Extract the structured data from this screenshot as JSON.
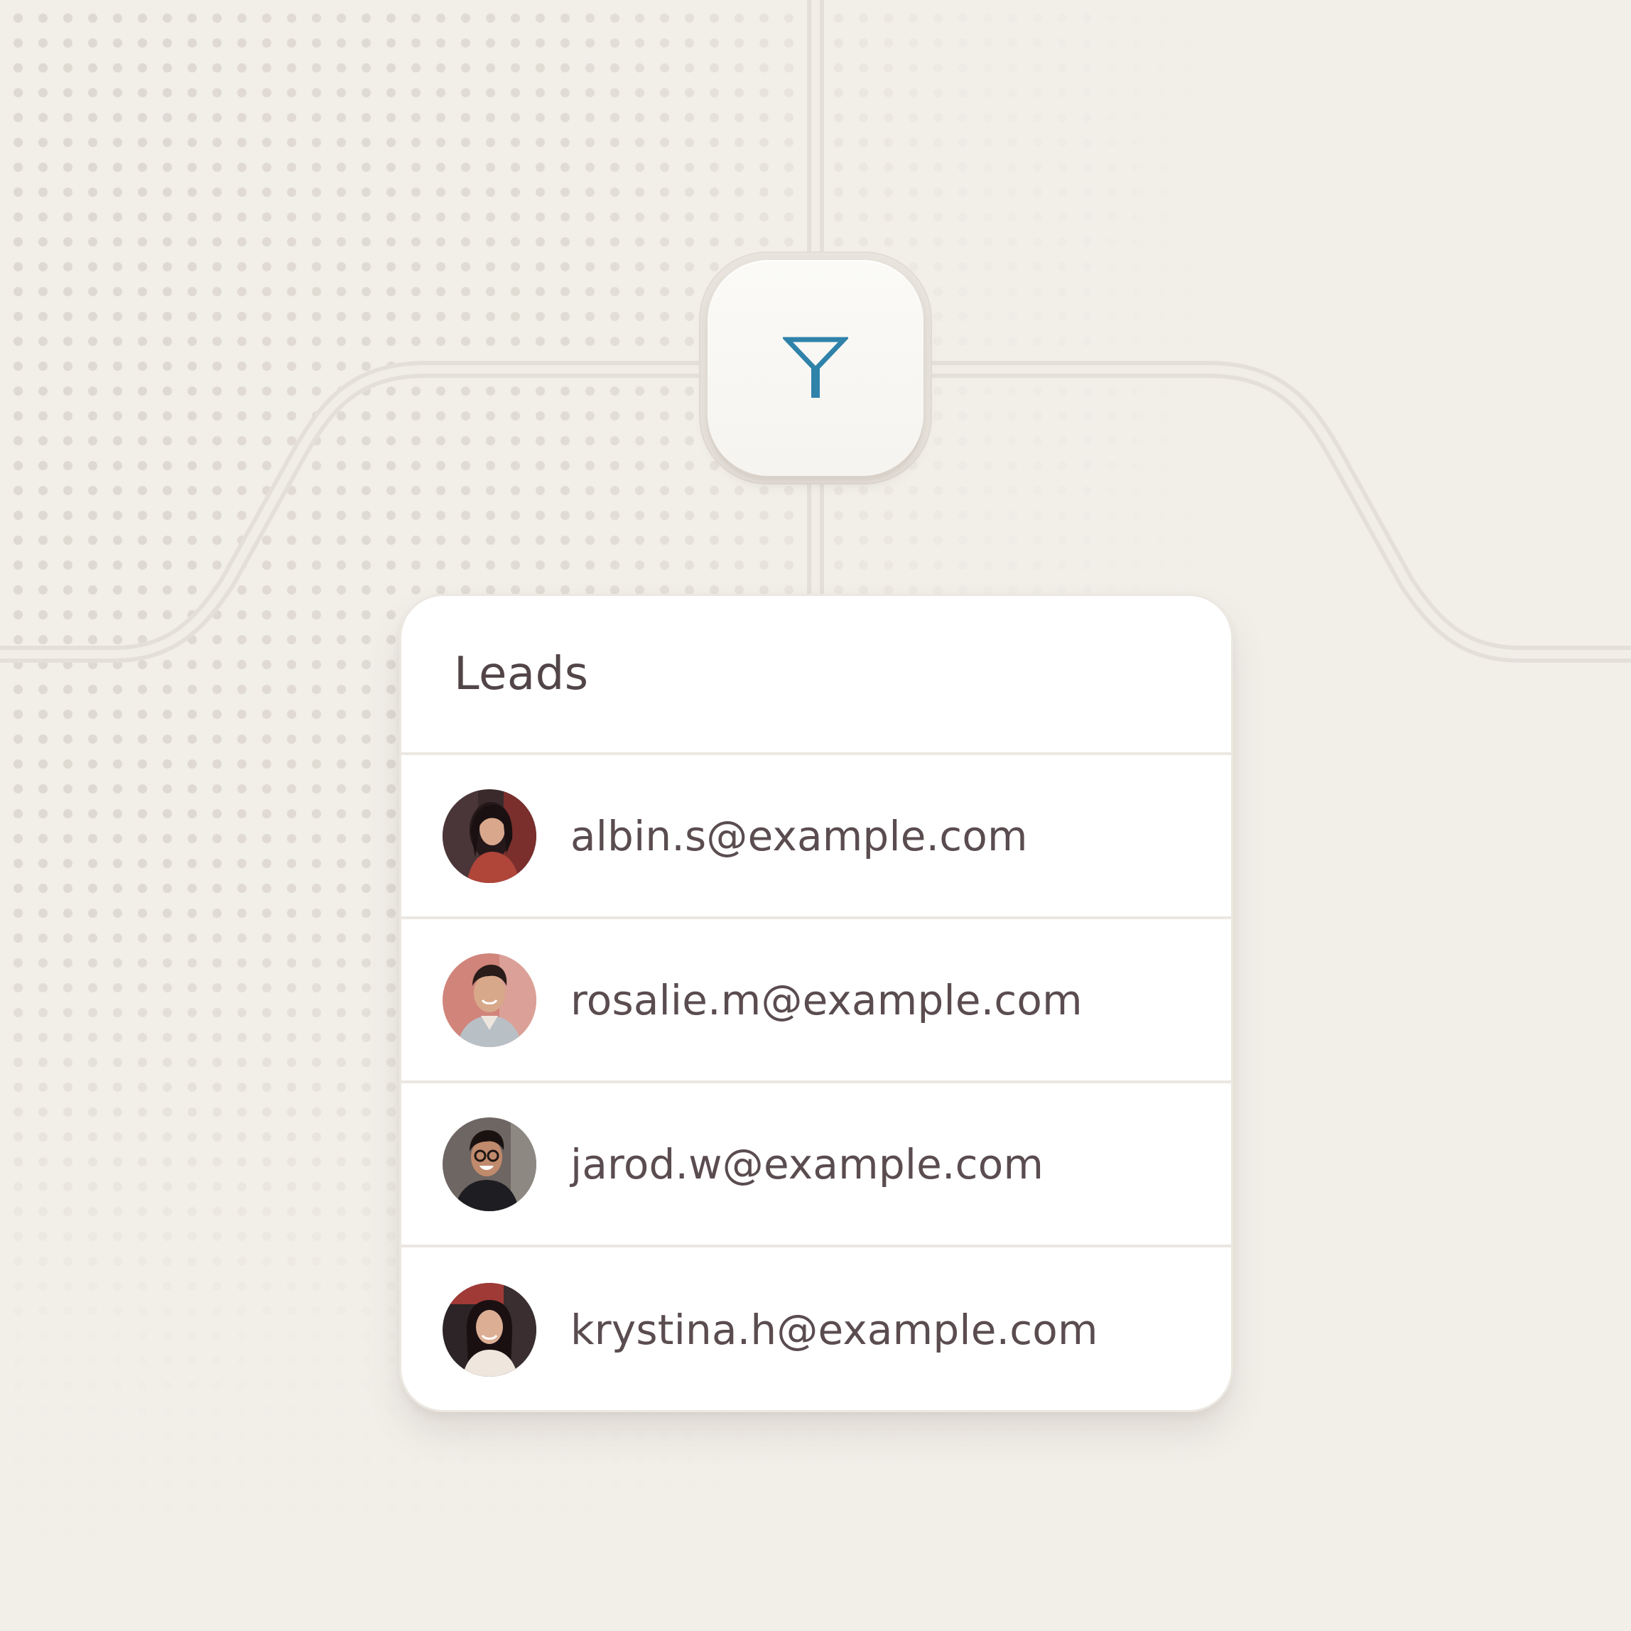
{
  "filter_node": {
    "icon": "filter-icon",
    "icon_color": "#2f82aa"
  },
  "leads_card": {
    "title": "Leads",
    "leads": [
      {
        "email": "albin.s@example.com",
        "avatar": "avatar-photo"
      },
      {
        "email": "rosalie.m@example.com",
        "avatar": "avatar-photo"
      },
      {
        "email": "jarod.w@example.com",
        "avatar": "avatar-photo"
      },
      {
        "email": "krystina.h@example.com",
        "avatar": "avatar-photo"
      }
    ]
  },
  "colors": {
    "background": "#f2efe9",
    "card": "#ffffff",
    "text": "#524548",
    "accent": "#2f82aa"
  }
}
